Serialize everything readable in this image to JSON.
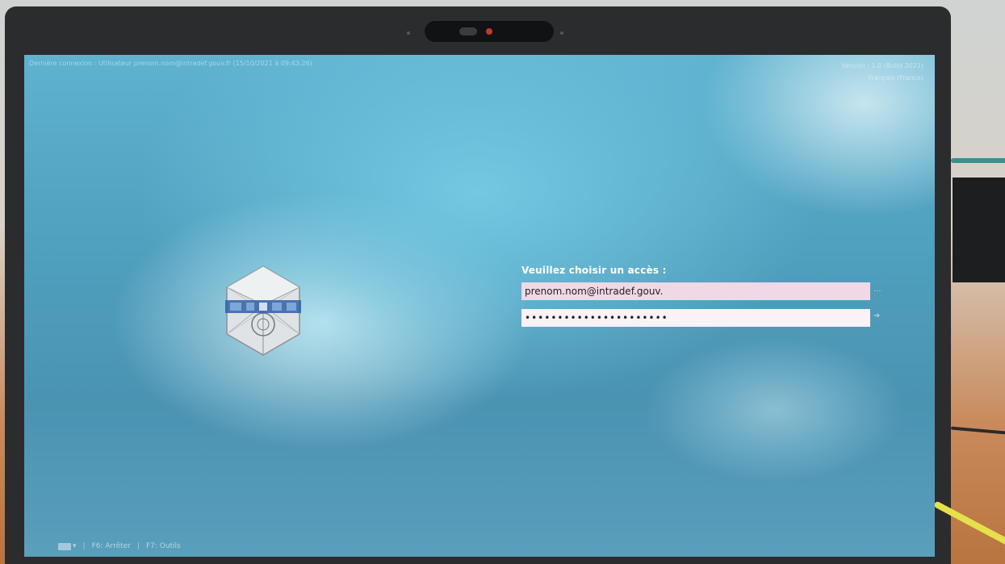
{
  "topbar": {
    "last_connection": "Dernière connexion : Utilisateur prenom.nom@intradef.gouv.fr (15/10/2021 à 09:43:26)",
    "version": "Version : 1.0 (Build 2021)",
    "language": "Français (France)"
  },
  "login": {
    "prompt": "Veuillez choisir un accès :",
    "username_value": "prenom.nom@intradef.gouv.",
    "password_value": "••••••••••••••••••••••",
    "more_label": "...",
    "submit_label": "➔"
  },
  "bottombar": {
    "keyboard_caret": "▾",
    "separator": "|",
    "f6_label": "F6: Arrêter",
    "f7_label": "F7: Outils"
  },
  "colors": {
    "screen_blue": "#5fb2d0",
    "username_field_bg": "#f0d8e6",
    "password_field_bg": "#faf2f6"
  }
}
